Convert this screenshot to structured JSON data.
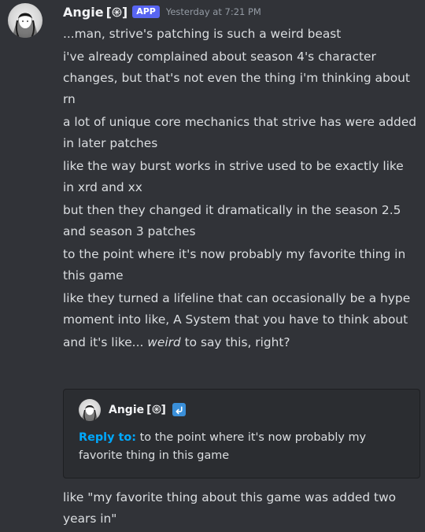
{
  "message": {
    "author": "Angie",
    "author_glyph": "[",
    "author_glyph_close": "]",
    "app_tag": "APP",
    "timestamp": "Yesterday at 7:21 PM",
    "lines": [
      "...man, strive's patching is such a weird beast",
      "i've already complained about season 4's character changes, but that's not even the thing i'm thinking about rn",
      "a lot of unique core mechanics that strive has were added in later patches",
      "like the way burst works in strive used to be exactly like in xrd and xx",
      "but then they changed it dramatically in the season 2.5 and season 3 patches",
      "to the point where it's now probably my favorite thing in this game",
      "like they turned a lifeline that can occasionally be a hype moment into like, A System that you have to think about"
    ],
    "last_line_prefix": "and it's like... ",
    "last_line_emphasis": "weird",
    "last_line_suffix": " to say this, right?"
  },
  "reply_card": {
    "author": "Angie",
    "label": "Reply to:",
    "text": "to the point where it's now probably my favorite thing in this game"
  },
  "after_reply": "like \"my favorite thing about this game was added two years in\"",
  "colors": {
    "background": "#313338",
    "app_tag": "#5865f2",
    "reply_label": "#00a8fc",
    "reply_icon": "#3a8fd9"
  },
  "icons": [
    "avatar",
    "server-badge-icon",
    "reply-arrow-icon"
  ]
}
